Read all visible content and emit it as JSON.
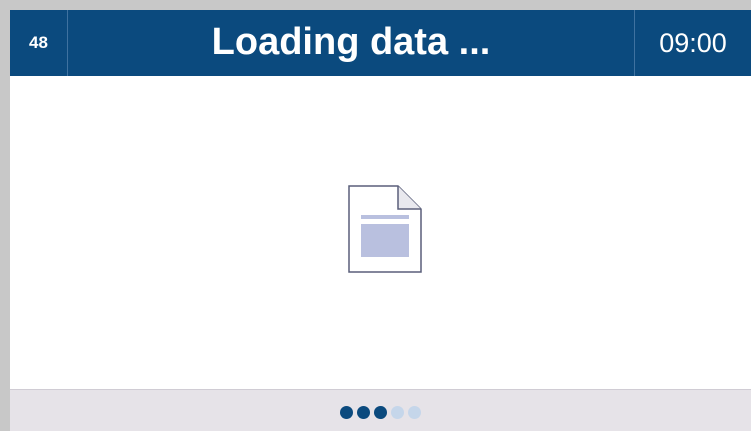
{
  "header": {
    "counter": "48",
    "title": "Loading data ...",
    "time": "09:00"
  },
  "content": {
    "icon": "document-icon"
  },
  "progress": {
    "total_dots": 5,
    "active_dots": 3
  },
  "colors": {
    "header_bg": "#0b4a7e",
    "active_dot": "#0b4a7e",
    "inactive_dot": "#c5d6ea",
    "footer_bg": "#e6e3e8"
  }
}
